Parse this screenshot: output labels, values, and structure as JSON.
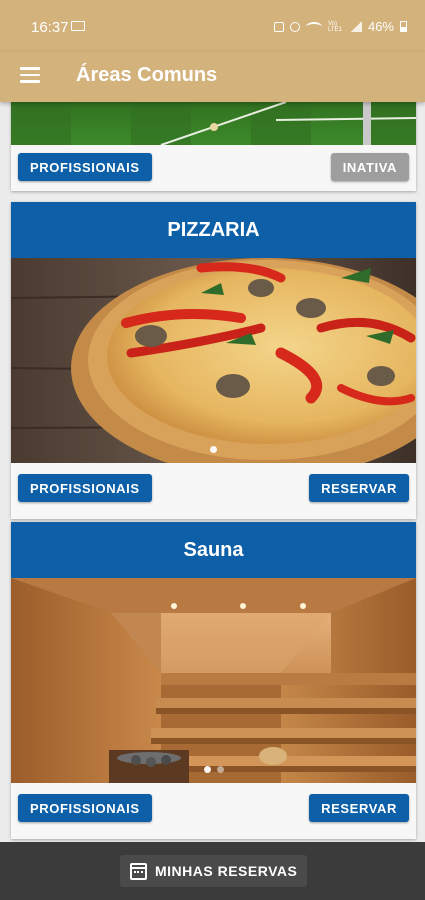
{
  "status_bar": {
    "time": "16:37",
    "battery": "46%",
    "network": "Vo) LTE1"
  },
  "app_bar": {
    "title": "Áreas Comuns",
    "menu_icon": "menu-icon"
  },
  "cards": [
    {
      "title": "",
      "left_button": "PROFISSIONAIS",
      "right_button": "INATIVA",
      "right_state": "inactive",
      "image": "football-field"
    },
    {
      "title": "PIZZARIA",
      "left_button": "PROFISSIONAIS",
      "right_button": "RESERVAR",
      "right_state": "active",
      "image": "pizza"
    },
    {
      "title": "Sauna",
      "left_button": "PROFISSIONAIS",
      "right_button": "RESERVAR",
      "right_state": "active",
      "image": "sauna"
    }
  ],
  "bottom_bar": {
    "label": "MINHAS RESERVAS",
    "icon": "calendar-icon"
  },
  "colors": {
    "accent": "#d3b27c",
    "primary": "#0d5fa8",
    "inactive": "#9e9e9e",
    "bottom": "#3b3b3b"
  }
}
